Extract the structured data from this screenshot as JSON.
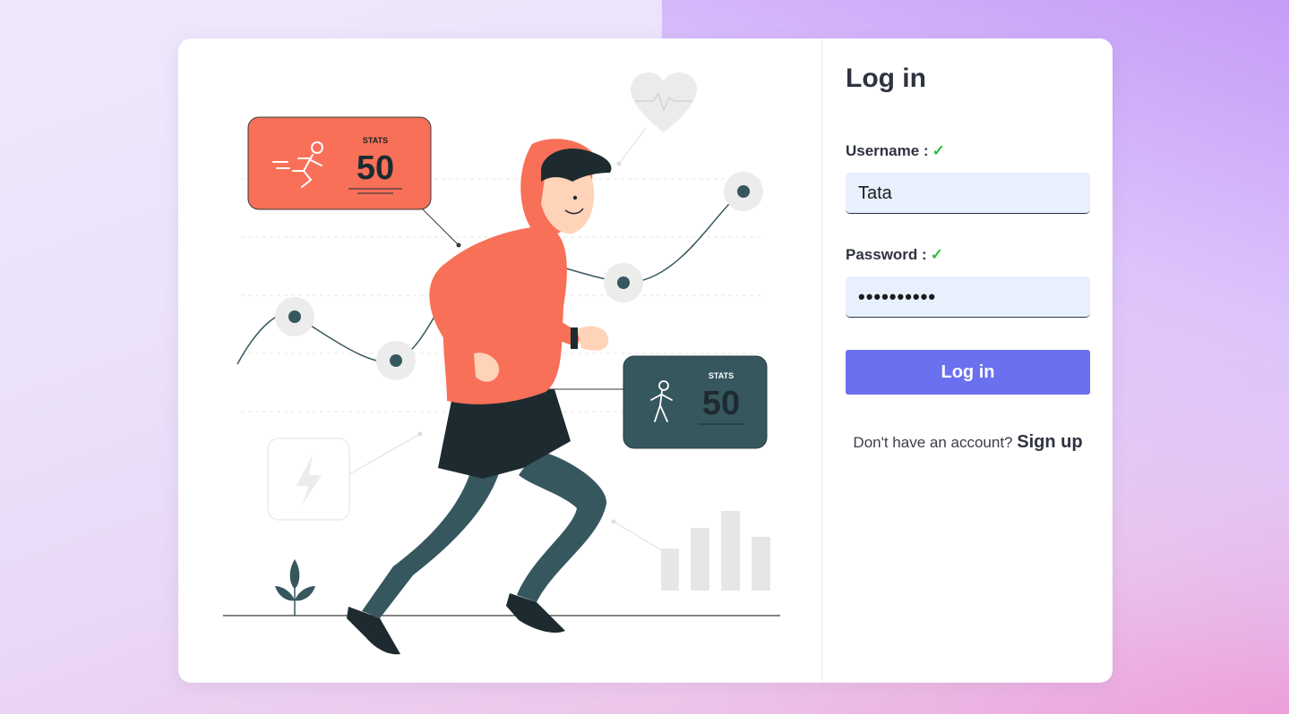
{
  "login": {
    "title": "Log in",
    "username_label": "Username :",
    "username_value": "Tata",
    "password_label": "Password :",
    "password_value": "••••••••••",
    "submit_label": "Log in",
    "signup_prompt": "Don't have an account?",
    "signup_link": "Sign up"
  },
  "illustration": {
    "stat_card_1_heading": "STATS",
    "stat_card_1_value": "50",
    "stat_card_2_heading": "STATS",
    "stat_card_2_value": "50"
  },
  "colors": {
    "accent": "#6b70ef",
    "valid_check": "#2bbf3a",
    "input_bg": "#e8f0fe",
    "coral": "#f87058",
    "slate": "#37575f"
  },
  "icons": [
    "check-icon",
    "running-person-icon",
    "walking-person-icon",
    "heart-icon",
    "lightning-icon",
    "plant-icon",
    "bar-chart-icon"
  ]
}
